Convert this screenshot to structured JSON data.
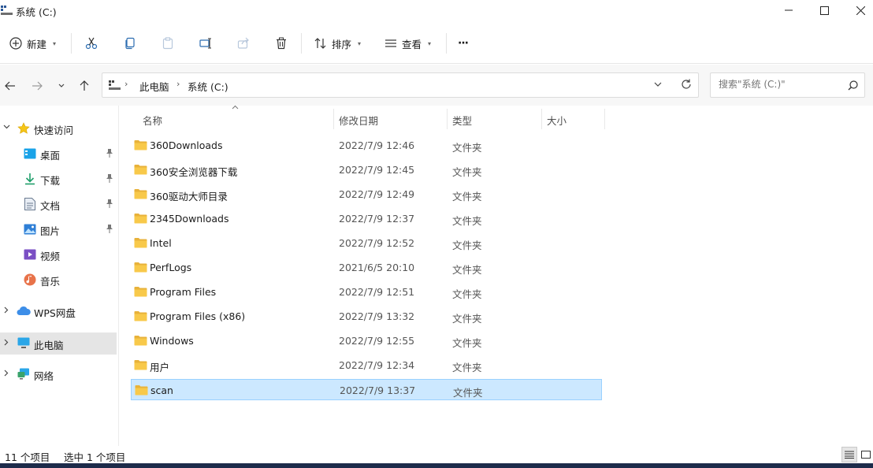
{
  "window": {
    "title": "系统 (C:)"
  },
  "toolbar": {
    "new_label": "新建",
    "sort_label": "排序",
    "view_label": "查看",
    "more_label": "···"
  },
  "address": {
    "segments": [
      "此电脑",
      "系统 (C:)"
    ]
  },
  "search": {
    "placeholder": "搜索\"系统 (C:)\""
  },
  "sidebar": {
    "quick_access": "快速访问",
    "items": [
      {
        "label": "桌面",
        "icon": "desktop-icon",
        "pinned": true
      },
      {
        "label": "下载",
        "icon": "download-icon",
        "pinned": true
      },
      {
        "label": "文档",
        "icon": "document-icon",
        "pinned": true
      },
      {
        "label": "图片",
        "icon": "picture-icon",
        "pinned": true
      },
      {
        "label": "视频",
        "icon": "video-icon",
        "pinned": false
      },
      {
        "label": "音乐",
        "icon": "music-icon",
        "pinned": false
      }
    ],
    "wps": "WPS网盘",
    "this_pc": "此电脑",
    "network": "网络"
  },
  "columns": {
    "name": "名称",
    "date": "修改日期",
    "type": "类型",
    "size": "大小"
  },
  "files": [
    {
      "name": "360Downloads",
      "date": "2022/7/9 12:46",
      "type": "文件夹"
    },
    {
      "name": "360安全浏览器下载",
      "date": "2022/7/9 12:45",
      "type": "文件夹"
    },
    {
      "name": "360驱动大师目录",
      "date": "2022/7/9 12:49",
      "type": "文件夹"
    },
    {
      "name": "2345Downloads",
      "date": "2022/7/9 12:37",
      "type": "文件夹"
    },
    {
      "name": "Intel",
      "date": "2022/7/9 12:52",
      "type": "文件夹"
    },
    {
      "name": "PerfLogs",
      "date": "2021/6/5 20:10",
      "type": "文件夹"
    },
    {
      "name": "Program Files",
      "date": "2022/7/9 12:51",
      "type": "文件夹"
    },
    {
      "name": "Program Files (x86)",
      "date": "2022/7/9 13:32",
      "type": "文件夹"
    },
    {
      "name": "Windows",
      "date": "2022/7/9 12:55",
      "type": "文件夹"
    },
    {
      "name": "用户",
      "date": "2022/7/9 12:34",
      "type": "文件夹"
    },
    {
      "name": "scan",
      "date": "2022/7/9 13:37",
      "type": "文件夹",
      "selected": true
    }
  ],
  "status": {
    "count": "11 个项目",
    "selection": "选中 1 个项目"
  },
  "colors": {
    "accent": "#0067c0",
    "selection": "#cce8ff",
    "selection_border": "#99d1ff",
    "folder": "#f8c94a"
  }
}
